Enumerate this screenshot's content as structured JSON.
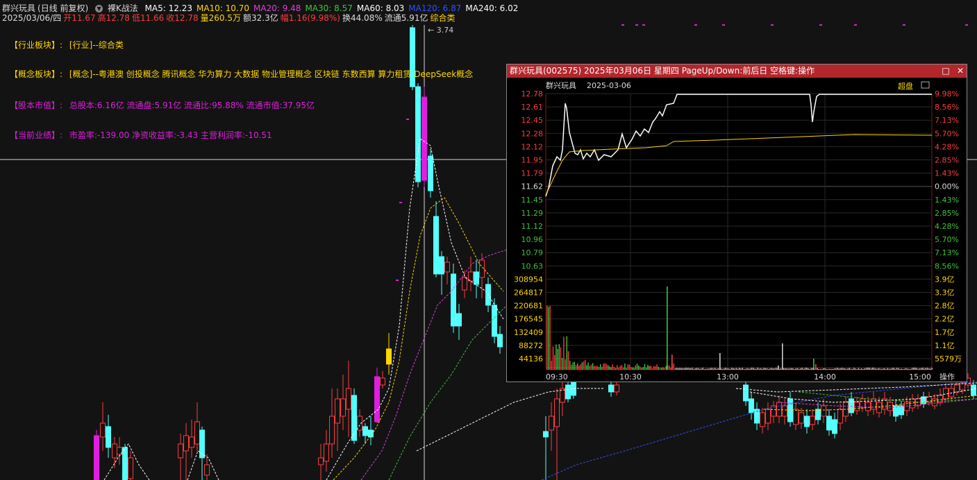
{
  "header": {
    "stock": "群兴玩具",
    "period": "(日线 前复权)",
    "strategy": "裸K战法",
    "ma": [
      {
        "label": "MA5: 12.23",
        "color": "#ffffff"
      },
      {
        "label": "MA10: 10.70",
        "color": "#ffd700"
      },
      {
        "label": "MA20: 9.48",
        "color": "#e040e0"
      },
      {
        "label": "MA30: 8.57",
        "color": "#3ec43e"
      },
      {
        "label": "MA60: 8.03",
        "color": "#ffffff"
      },
      {
        "label": "MA120: 6.87",
        "color": "#3050ff"
      },
      {
        "label": "MA240: 6.02",
        "color": "#ffffff"
      }
    ],
    "quote": [
      {
        "text": "2025/03/06/四",
        "color": "#dddddd"
      },
      {
        "text": "开11.67",
        "color": "#ff3c3c"
      },
      {
        "text": "高12.78",
        "color": "#ff3c3c"
      },
      {
        "text": "低11.66",
        "color": "#ff3c3c"
      },
      {
        "text": "收12.78",
        "color": "#ff3c3c"
      },
      {
        "text": "量260.5万",
        "color": "#ffd700"
      },
      {
        "text": "额32.3亿",
        "color": "#dddddd"
      },
      {
        "text": "幅1.16(9.98%)",
        "color": "#ff3c3c"
      },
      {
        "text": "换44.08%",
        "color": "#dddddd"
      },
      {
        "text": "流通5.91亿",
        "color": "#dddddd"
      },
      {
        "text": "综合类",
        "color": "#ffd700"
      }
    ]
  },
  "info": {
    "industry_label": "【行业板块】:",
    "industry_value": "[行业]--综合类",
    "concept_label": "【概念板块】:",
    "concept_value": "[概念]--粤港澳 创投概念 腾讯概念 华为算力 大数据 物业管理概念 区块链 东数西算 算力租赁 DeepSeek概念",
    "cap_label": "【股本市值】:",
    "cap_value": "总股本:6.16亿   流通盘:5.91亿   流通比:95.88%   流通市值:37.95亿",
    "perf_label": "【当前业绩】:",
    "perf_value": "市盈率:-139.00   净资收益率:-3.43   主营利润率:-10.51"
  },
  "chart_marker": "3.74",
  "popup": {
    "title": "群兴玩具(002575) 2025年03月06日 星期四 PageUp/Down:前后日 空格键:操作",
    "name": "群兴玩具",
    "date": "2025-03-06",
    "superpan": "超盘",
    "ops": "操作",
    "price_labels": [
      "12.78",
      "12.61",
      "12.45",
      "12.28",
      "12.12",
      "11.95",
      "11.79",
      "11.62",
      "11.45",
      "11.29",
      "11.12",
      "10.96",
      "10.79",
      "10.63"
    ],
    "pct_labels": [
      "9.98%",
      "8.56%",
      "7.13%",
      "5.70%",
      "4.28%",
      "2.85%",
      "1.43%",
      "0.00%",
      "1.43%",
      "2.85%",
      "4.28%",
      "5.70%",
      "7.13%",
      "8.56%"
    ],
    "vol_labels": [
      "308954",
      "264817",
      "220681",
      "176545",
      "132409",
      "88272",
      "44136"
    ],
    "amt_labels": [
      "3.9亿",
      "3.3亿",
      "2.8亿",
      "2.2亿",
      "1.7亿",
      "1.1亿",
      "5579万"
    ],
    "time_labels": [
      "09:30",
      "10:30",
      "13:00",
      "14:00",
      "15:00"
    ],
    "prev_close": 11.62,
    "price_max": 12.78,
    "price_min": 10.63
  },
  "colors": {
    "up": "#ff3c3c",
    "down": "#54ffff",
    "magenta": "#e01ee0",
    "yellow": "#ffd700",
    "green": "#3ec43e"
  }
}
